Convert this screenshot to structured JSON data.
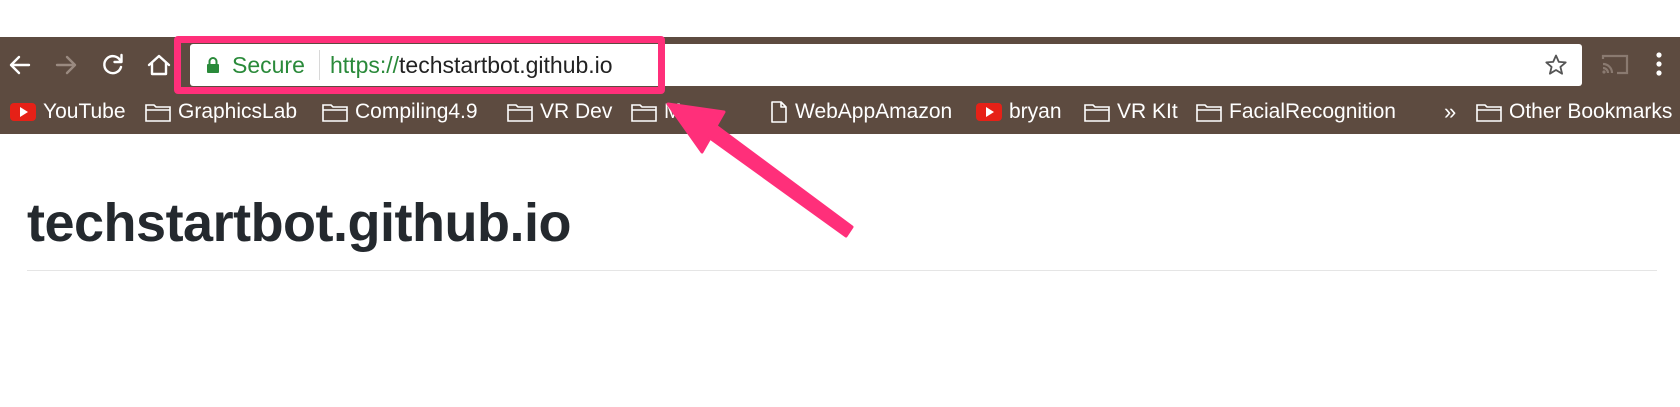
{
  "browser": {
    "omnibox": {
      "secure_label": "Secure",
      "url_scheme": "https://",
      "url_host": "techstartbot.github.io"
    },
    "nav_icons": [
      "back-icon",
      "forward-icon",
      "reload-icon",
      "home-icon"
    ],
    "right_icons": [
      "star-icon",
      "cast-icon",
      "menu-icon"
    ]
  },
  "bookmarks": {
    "items": [
      {
        "label": "YouTube",
        "icon": "youtube-icon"
      },
      {
        "label": "GraphicsLab",
        "icon": "folder-icon"
      },
      {
        "label": "Compiling4.9",
        "icon": "folder-icon"
      },
      {
        "label": "VR Dev",
        "icon": "folder-icon"
      },
      {
        "label": "Mo",
        "icon": "folder-icon"
      },
      {
        "label": "WebAppAmazon",
        "icon": "page-icon"
      },
      {
        "label": "bryan",
        "icon": "youtube-icon"
      },
      {
        "label": "VR KIt",
        "icon": "folder-icon"
      },
      {
        "label": "FacialRecognition",
        "icon": "folder-icon"
      }
    ],
    "overflow_chevron": "»",
    "other": {
      "label": "Other Bookmarks",
      "icon": "folder-icon"
    }
  },
  "page": {
    "title": "techstartbot.github.io"
  },
  "colors": {
    "toolbar_bg": "#5d4b40",
    "secure_green": "#2a8a3a",
    "highlight_pink": "#ff2f7a",
    "title_color": "#24292e"
  }
}
